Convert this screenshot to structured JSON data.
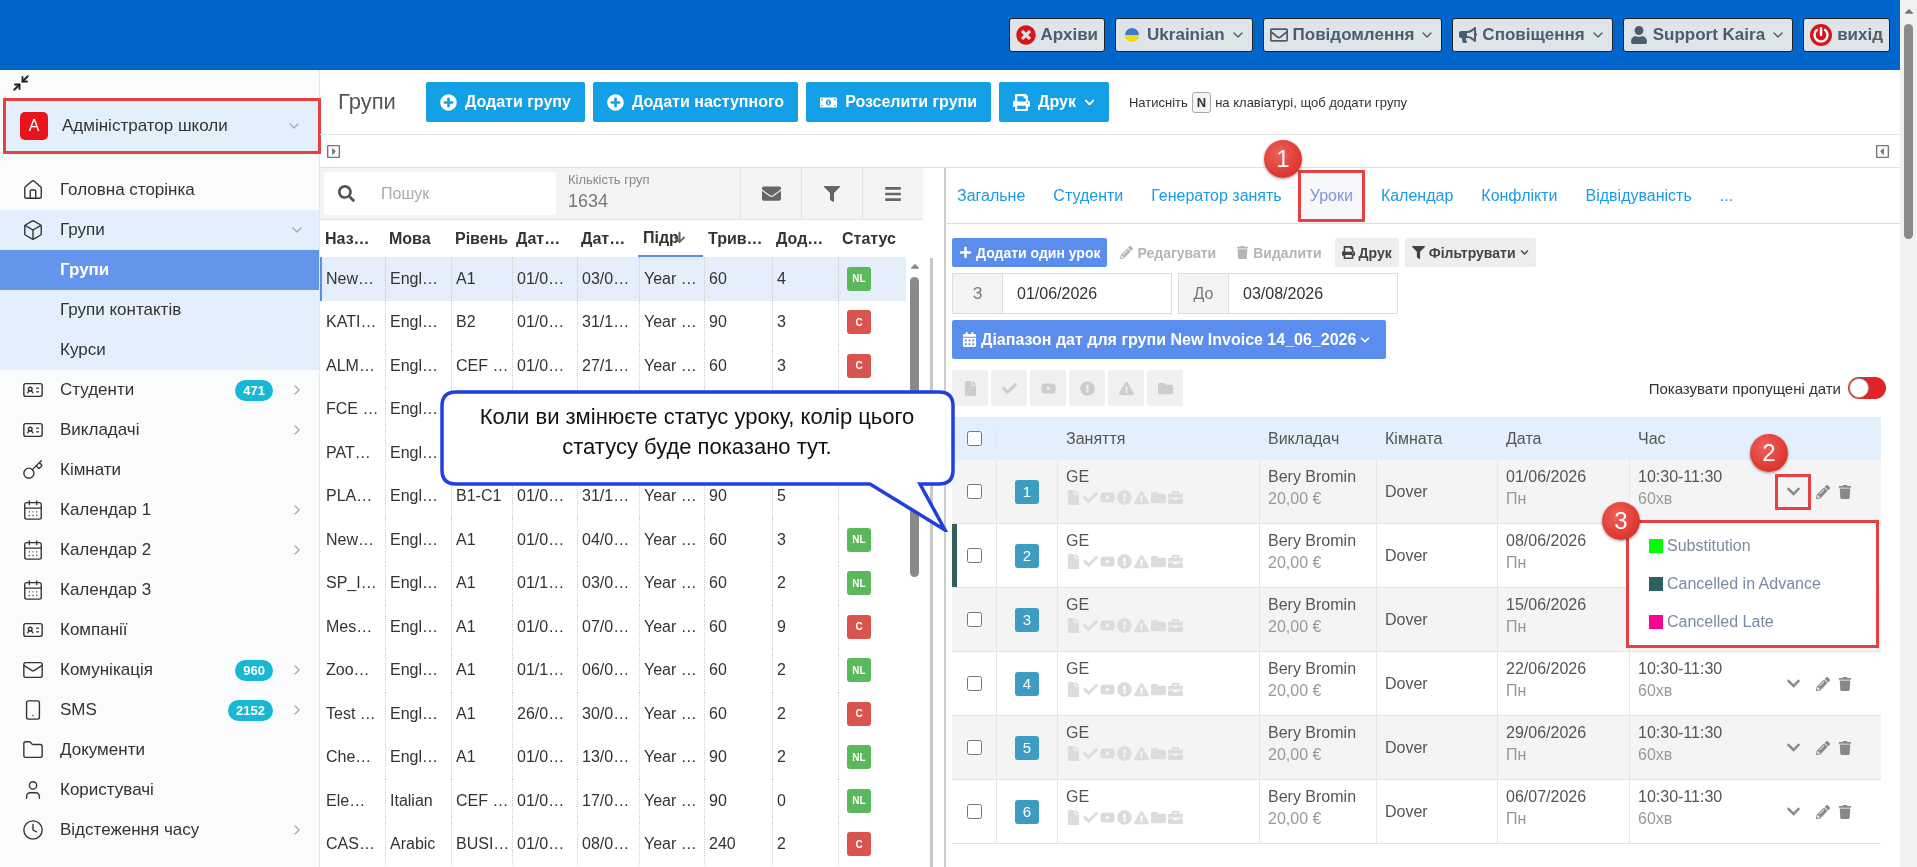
{
  "top_bar": {
    "buttons": [
      {
        "label": "Архіви",
        "caret": false
      },
      {
        "label": "Ukrainian",
        "caret": true
      },
      {
        "label": "Повідомлення",
        "caret": true
      },
      {
        "label": "Сповіщення",
        "caret": true
      },
      {
        "label": "Support Kaira",
        "caret": true
      },
      {
        "label": "вихід",
        "caret": false
      }
    ]
  },
  "sidebar": {
    "account": {
      "initial": "A",
      "name": "Адміністратор школи",
      "highlighted": true
    },
    "items": [
      {
        "label": "Головна сторінка",
        "expandable": false
      },
      {
        "label": "Групи",
        "expandable": true,
        "expanded": true,
        "children": [
          {
            "label": "Групи",
            "selected": true
          },
          {
            "label": "Групи контактів",
            "selected": false
          },
          {
            "label": "Курси",
            "selected": false
          }
        ]
      },
      {
        "label": "Студенти",
        "badge": "471",
        "expandable": true,
        "expanded": false
      },
      {
        "label": "Викладачі",
        "expandable": true,
        "expanded": false
      },
      {
        "label": "Кімнати",
        "expandable": false
      },
      {
        "label": "Календар 1",
        "expandable": true,
        "expanded": false
      },
      {
        "label": "Календар 2",
        "expandable": true,
        "expanded": false
      },
      {
        "label": "Календар 3",
        "expandable": false
      },
      {
        "label": "Компанії",
        "expandable": false
      },
      {
        "label": "Комунікація",
        "badge": "960",
        "expandable": true,
        "expanded": false
      },
      {
        "label": "SMS",
        "badge": "2152",
        "expandable": true,
        "expanded": false
      },
      {
        "label": "Документи",
        "expandable": false
      },
      {
        "label": "Користувачі",
        "expandable": false
      },
      {
        "label": "Відстеження часу",
        "expandable": true,
        "expanded": false
      }
    ]
  },
  "header": {
    "title": "Групи",
    "buttons": [
      {
        "label": "Додати групу",
        "caret": false
      },
      {
        "label": "Додати наступного",
        "caret": false
      },
      {
        "label": "Розселити групи",
        "caret": false
      },
      {
        "label": "Друк",
        "caret": true
      }
    ],
    "hint": {
      "before": "Натисніть",
      "key": "N",
      "after": "на клавіатурі, щоб додати групу"
    }
  },
  "groups": {
    "search": {
      "placeholder": "Пошук"
    },
    "count": {
      "label": "Кількість груп",
      "value": "1634"
    },
    "columns": [
      {
        "label": "Наз…",
        "sorted": false
      },
      {
        "label": "Мова",
        "sorted": false
      },
      {
        "label": "Рівень",
        "sorted": false
      },
      {
        "label": "Дат…",
        "sorted": false
      },
      {
        "label": "Дат…",
        "sorted": false
      },
      {
        "label": "Підр",
        "sorted": true
      },
      {
        "label": "Трив…",
        "sorted": false
      },
      {
        "label": "Дод…",
        "sorted": false
      },
      {
        "label": "Статус",
        "sorted": false
      }
    ],
    "rows": [
      {
        "selected": true,
        "cells": [
          "New…",
          "Engl…",
          "A1",
          "01/0…",
          "03/0…",
          "Year …",
          "60",
          "4"
        ],
        "status": {
          "text": "NL",
          "color": "#5cb85c"
        }
      },
      {
        "selected": false,
        "cells": [
          "KATI…",
          "Engl…",
          "B2",
          "01/0…",
          "31/1…",
          "Year …",
          "90",
          "3"
        ],
        "status": {
          "text": "C",
          "color": "#d9534f"
        }
      },
      {
        "selected": false,
        "cells": [
          "ALM…",
          "Engl…",
          "CEF …",
          "01/0…",
          "27/1…",
          "Year …",
          "60",
          "3"
        ],
        "status": {
          "text": "C",
          "color": "#d9534f"
        }
      },
      {
        "selected": false,
        "cells": [
          "FCE …",
          "Engl…"
        ]
      },
      {
        "selected": false,
        "cells": [
          "PAT…",
          "Engl…"
        ]
      },
      {
        "selected": false,
        "cells": [
          "PLA…",
          "Engl…",
          "B1-C1",
          "01/0…",
          "31/1…",
          "Year …",
          "90",
          "5"
        ]
      },
      {
        "selected": false,
        "cells": [
          "New…",
          "Engl…",
          "A1",
          "01/0…",
          "04/0…",
          "Year …",
          "60",
          "3"
        ],
        "status": {
          "text": "NL",
          "color": "#5cb85c"
        }
      },
      {
        "selected": false,
        "cells": [
          "SP_I…",
          "Engl…",
          "A1",
          "01/1…",
          "03/0…",
          "Year …",
          "60",
          "2"
        ],
        "status": {
          "text": "NL",
          "color": "#5cb85c"
        }
      },
      {
        "selected": false,
        "cells": [
          "Mes…",
          "Engl…",
          "A1",
          "01/0…",
          "07/0…",
          "Year …",
          "60",
          "9"
        ],
        "status": {
          "text": "C",
          "color": "#d9534f"
        }
      },
      {
        "selected": false,
        "cells": [
          "Zoo…",
          "Engl…",
          "A1",
          "01/1…",
          "06/0…",
          "Year …",
          "60",
          "2"
        ],
        "status": {
          "text": "NL",
          "color": "#5cb85c"
        }
      },
      {
        "selected": false,
        "cells": [
          "Test …",
          "Engl…",
          "A1",
          "26/0…",
          "30/0…",
          "Year …",
          "60",
          "2"
        ],
        "status": {
          "text": "C",
          "color": "#d9534f"
        }
      },
      {
        "selected": false,
        "cells": [
          "Che…",
          "Engl…",
          "A1",
          "01/0…",
          "13/0…",
          "Year …",
          "90",
          "2"
        ],
        "status": {
          "text": "NL",
          "color": "#5cb85c"
        }
      },
      {
        "selected": false,
        "cells": [
          "Ele…",
          "Italian",
          "CEF …",
          "01/0…",
          "17/0…",
          "Year …",
          "90",
          "0"
        ],
        "status": {
          "text": "NL",
          "color": "#5cb85c"
        }
      },
      {
        "selected": false,
        "cells": [
          "CAS…",
          "Arabic",
          "BUSI…",
          "01/0…",
          "08/0…",
          "Year …",
          "240",
          "2"
        ],
        "status": {
          "text": "C",
          "color": "#d9534f"
        }
      }
    ]
  },
  "group_tabs": [
    {
      "label": "Загальне",
      "selected": false,
      "highlighted": false
    },
    {
      "label": "Студенти",
      "selected": false,
      "highlighted": false
    },
    {
      "label": "Генератор занять",
      "selected": false,
      "highlighted": false
    },
    {
      "label": "Уроки",
      "selected": true,
      "highlighted": true
    },
    {
      "label": "Календар",
      "selected": false,
      "highlighted": false
    },
    {
      "label": "Конфлікти",
      "selected": false,
      "highlighted": false
    },
    {
      "label": "Відвідуваність",
      "selected": false,
      "highlighted": false
    },
    {
      "label": "...",
      "selected": false,
      "highlighted": false
    }
  ],
  "lessons": {
    "toolbar": [
      {
        "label": "Додати один урок",
        "kind": "primary",
        "disabled": false
      },
      {
        "label": "Редагувати",
        "kind": "plain",
        "disabled": true
      },
      {
        "label": "Видалити",
        "kind": "plain",
        "disabled": true
      },
      {
        "label": "Друк",
        "kind": "grey",
        "disabled": false
      },
      {
        "label": "Фільтрувати",
        "kind": "dropdown",
        "disabled": false
      }
    ],
    "from": {
      "label": "З",
      "value": "01/06/2026"
    },
    "to": {
      "label": "До",
      "value": "03/08/2026"
    },
    "range_button": "Діапазон дат для групи New Invoice 14_06_2026",
    "icon_buttons": [
      {
        "disabled": true
      },
      {
        "disabled": true
      },
      {
        "disabled": true
      },
      {
        "disabled": true
      },
      {
        "disabled": true
      },
      {
        "disabled": true
      }
    ],
    "show_skipped": {
      "label": "Показувати пропущені дати",
      "on": false
    },
    "select_all": {
      "checked": false
    },
    "columns": [
      "Заняття",
      "Викладач",
      "Кімната",
      "Дата",
      "Час"
    ],
    "rows": [
      {
        "number": "1",
        "checked": false,
        "subject": "GE",
        "teacher": "Bery Bromin",
        "price": "20,00 €",
        "room": "Dover",
        "date": "01/06/2026",
        "weekday": "Пн",
        "time": "10:30-11:30",
        "duration": "60хв",
        "action_highlighted": true
      },
      {
        "number": "2",
        "checked": false,
        "subject": "GE",
        "teacher": "Bery Bromin",
        "price": "20,00 €",
        "room": "Dover",
        "date": "08/06/2026",
        "weekday": "Пн",
        "color": "#2f5f5f"
      },
      {
        "number": "3",
        "checked": false,
        "subject": "GE",
        "teacher": "Bery Bromin",
        "price": "20,00 €",
        "room": "Dover",
        "date": "15/06/2026",
        "weekday": "Пн"
      },
      {
        "number": "4",
        "checked": false,
        "subject": "GE",
        "teacher": "Bery Bromin",
        "price": "20,00 €",
        "room": "Dover",
        "date": "22/06/2026",
        "weekday": "Пн",
        "time": "10:30-11:30",
        "duration": "60хв",
        "action_highlighted": false
      },
      {
        "number": "5",
        "checked": false,
        "subject": "GE",
        "teacher": "Bery Bromin",
        "price": "20,00 €",
        "room": "Dover",
        "date": "29/06/2026",
        "weekday": "Пн",
        "time": "10:30-11:30",
        "duration": "60хв",
        "action_highlighted": false
      },
      {
        "number": "6",
        "checked": false,
        "subject": "GE",
        "teacher": "Bery Bromin",
        "price": "20,00 €",
        "room": "Dover",
        "date": "06/07/2026",
        "weekday": "Пн",
        "time": "10:30-11:30",
        "duration": "60хв",
        "action_highlighted": false
      }
    ]
  },
  "status_menu": {
    "highlighted": true,
    "items": [
      {
        "label": "Substitution",
        "color": "#00ff00"
      },
      {
        "label": "Cancelled in Advance",
        "color": "#2f5f5f"
      },
      {
        "label": "Cancelled Late",
        "color": "#ff0090"
      }
    ]
  },
  "callout": {
    "text": "Коли ви змінюєте статус уроку, колір цього статусу буде показано тут."
  },
  "annotations": [
    {
      "number": "1"
    },
    {
      "number": "2"
    },
    {
      "number": "3"
    }
  ]
}
